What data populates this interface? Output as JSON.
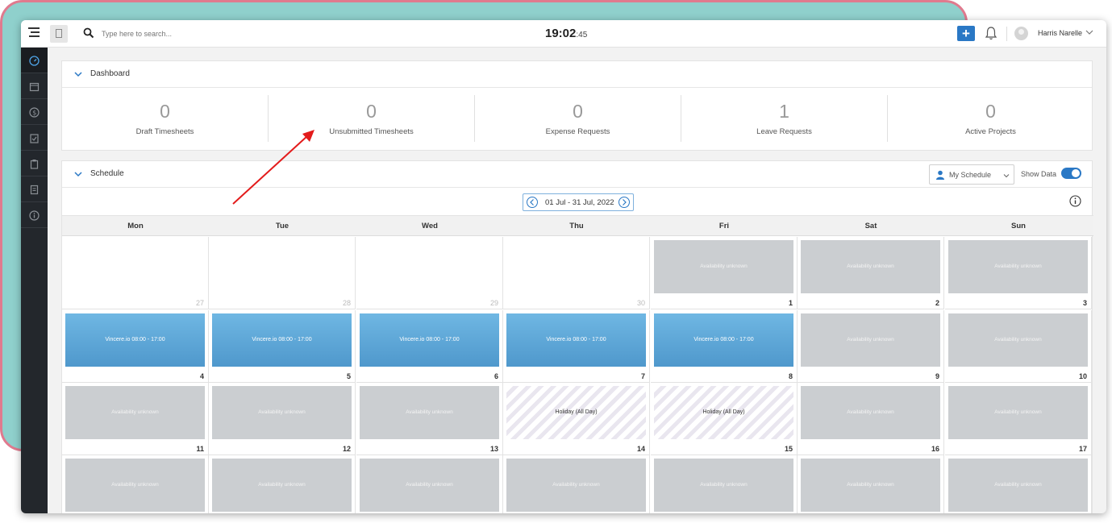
{
  "topbar": {
    "search_placeholder": "Type here to search...",
    "clock_hm": "19:02",
    "clock_sec": ":45",
    "add_label": "+",
    "username": "Harris Narelle"
  },
  "sidebar": {
    "items": [
      {
        "icon": "dashboard-gauge-icon"
      },
      {
        "icon": "calendar-icon"
      },
      {
        "icon": "dollar-icon"
      },
      {
        "icon": "timesheet-icon"
      },
      {
        "icon": "clipboard-icon"
      },
      {
        "icon": "document-icon"
      },
      {
        "icon": "info-icon"
      }
    ]
  },
  "dashboard": {
    "title": "Dashboard",
    "stats": [
      {
        "value": "0",
        "label": "Draft Timesheets"
      },
      {
        "value": "0",
        "label": "Unsubmitted Timesheets"
      },
      {
        "value": "0",
        "label": "Expense Requests"
      },
      {
        "value": "1",
        "label": "Leave Requests"
      },
      {
        "value": "0",
        "label": "Active Projects"
      }
    ]
  },
  "schedule": {
    "title": "Schedule",
    "filter_label": "My Schedule",
    "show_data_label": "Show Data",
    "date_range": "01 Jul - 31 Jul, 2022",
    "days": [
      "Mon",
      "Tue",
      "Wed",
      "Thu",
      "Fri",
      "Sat",
      "Sun"
    ],
    "weeks": [
      [
        {
          "day": "27",
          "prev": true,
          "type": "empty"
        },
        {
          "day": "28",
          "prev": true,
          "type": "empty"
        },
        {
          "day": "29",
          "prev": true,
          "type": "empty"
        },
        {
          "day": "30",
          "prev": true,
          "type": "empty"
        },
        {
          "day": "1",
          "type": "avail",
          "text": "Availability unknown"
        },
        {
          "day": "2",
          "type": "avail",
          "text": "Availability unknown"
        },
        {
          "day": "3",
          "type": "avail",
          "text": "Availability unknown"
        }
      ],
      [
        {
          "day": "4",
          "type": "work",
          "text": "Vincere.io  08:00 - 17:00"
        },
        {
          "day": "5",
          "type": "work",
          "text": "Vincere.io  08:00 - 17:00"
        },
        {
          "day": "6",
          "type": "work",
          "text": "Vincere.io  08:00 - 17:00"
        },
        {
          "day": "7",
          "type": "work",
          "text": "Vincere.io  08:00 - 17:00"
        },
        {
          "day": "8",
          "type": "work",
          "text": "Vincere.io  08:00 - 17:00"
        },
        {
          "day": "9",
          "type": "avail",
          "text": "Availability unknown"
        },
        {
          "day": "10",
          "type": "avail",
          "text": "Availability unknown"
        }
      ],
      [
        {
          "day": "11",
          "type": "avail",
          "text": "Availability unknown"
        },
        {
          "day": "12",
          "type": "avail",
          "text": "Availability unknown"
        },
        {
          "day": "13",
          "type": "avail",
          "text": "Availability unknown"
        },
        {
          "day": "14",
          "type": "hol",
          "text": "Holiday (All Day)"
        },
        {
          "day": "15",
          "type": "hol",
          "text": "Holiday (All Day)"
        },
        {
          "day": "16",
          "type": "avail",
          "text": "Availability unknown"
        },
        {
          "day": "17",
          "type": "avail",
          "text": "Availability unknown"
        }
      ],
      [
        {
          "day": "",
          "type": "avail",
          "text": "Availability unknown"
        },
        {
          "day": "",
          "type": "avail",
          "text": "Availability unknown"
        },
        {
          "day": "",
          "type": "avail",
          "text": "Availability unknown"
        },
        {
          "day": "",
          "type": "avail",
          "text": "Availability unknown"
        },
        {
          "day": "",
          "type": "avail",
          "text": "Availability unknown"
        },
        {
          "day": "",
          "type": "avail",
          "text": "Availability unknown"
        },
        {
          "day": "",
          "type": "avail",
          "text": "Availability unknown"
        }
      ]
    ]
  },
  "colors": {
    "accent": "#2a78c5",
    "work_block": "#5ba6d6",
    "avail_block": "#cbced1",
    "annotation_arrow": "#e31b1b",
    "background_shape": "#8fd0cc"
  }
}
